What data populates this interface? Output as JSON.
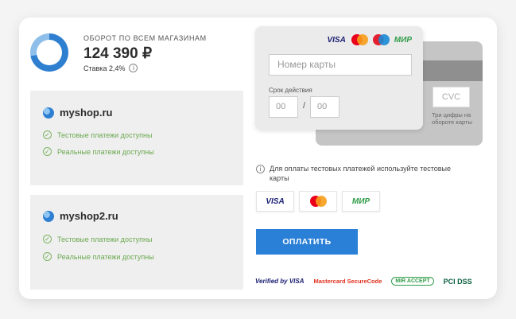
{
  "summary": {
    "label": "ОБОРОТ ПО ВСЕМ МАГАЗИНАМ",
    "amount": "124 390 ₽",
    "rate": "Ставка 2,4%",
    "info_icon": "info-circle-icon"
  },
  "shops": [
    {
      "name": "myshop.ru",
      "statuses": [
        "Тестовые платежи доступны",
        "Реальные платежи доступны"
      ]
    },
    {
      "name": "myshop2.ru",
      "statuses": [
        "Тестовые платежи доступны",
        "Реальные платежи доступны"
      ]
    }
  ],
  "card_form": {
    "brands": [
      "VISA",
      "Mastercard",
      "Maestro",
      "МИР"
    ],
    "card_number_placeholder": "Номер карты",
    "expiry_label": "Срок действия",
    "month_placeholder": "00",
    "year_placeholder": "00",
    "separator": "/",
    "cvc_placeholder": "CVC",
    "cvc_hint": "Три цифры на обороте карты"
  },
  "note": "Для оплаты тестовых платежей используйте тестовые карты",
  "test_cards": [
    "VISA",
    "Mastercard",
    "МИР"
  ],
  "pay_button": "ОПЛАТИТЬ",
  "security_badges": {
    "visa": "Verified by VISA",
    "mastercard": "Mastercard SecureCode",
    "mir": "MIR ACCEPT",
    "pci": "PCI DSS"
  },
  "colors": {
    "accent": "#2a7fd6",
    "success": "#6aa84f",
    "panel": "#efefef"
  }
}
